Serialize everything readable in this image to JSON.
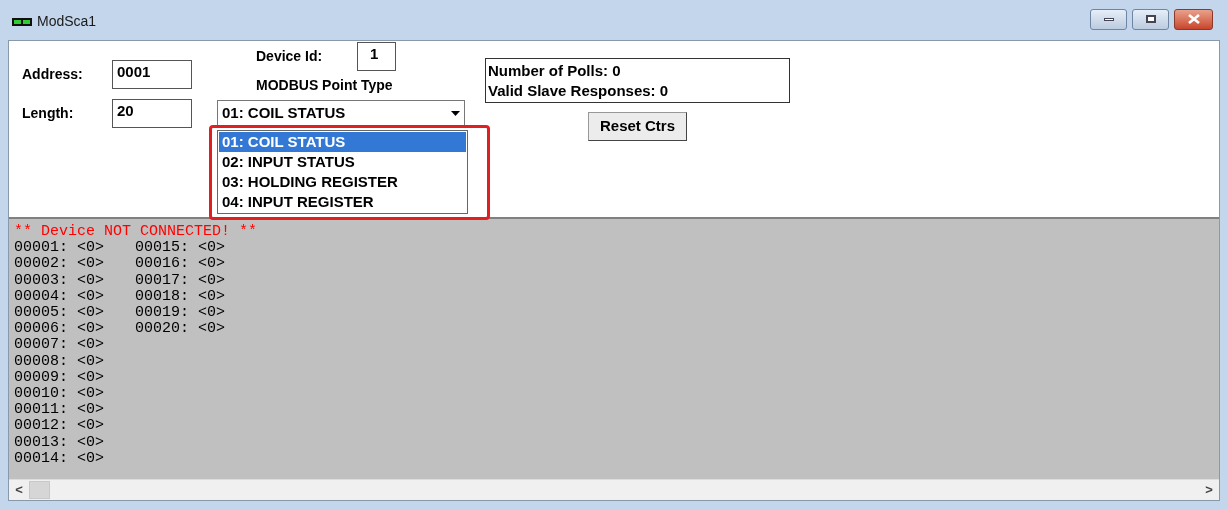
{
  "window": {
    "title": "ModSca1"
  },
  "fields": {
    "address_label": "Address:",
    "address": "0001",
    "length_label": "Length:",
    "length": "20",
    "device_id_label": "Device Id:",
    "device_id": "1",
    "point_type_label": "MODBUS Point Type"
  },
  "point_type": {
    "value": "01: COIL STATUS",
    "expanded": true,
    "options": [
      {
        "label": "01: COIL STATUS",
        "selected": true
      },
      {
        "label": "02: INPUT STATUS",
        "selected": false
      },
      {
        "label": "03: HOLDING REGISTER",
        "selected": false
      },
      {
        "label": "04: INPUT REGISTER",
        "selected": false
      }
    ]
  },
  "counters": [
    "Number of Polls: 0",
    "Valid Slave Responses: 0"
  ],
  "reset_button": "Reset Ctrs",
  "output": {
    "status": "** Device NOT CONNECTED! **",
    "readings": [
      "00001: <0>",
      "00002: <0>",
      "00003: <0>",
      "00004: <0>",
      "00005: <0>",
      "00006: <0>",
      "00007: <0>",
      "00008: <0>",
      "00009: <0>",
      "00010: <0>",
      "00011: <0>",
      "00012: <0>",
      "00013: <0>",
      "00014: <0>",
      "00015: <0>",
      "00016: <0>",
      "00017: <0>",
      "00018: <0>",
      "00019: <0>",
      "00020: <0>"
    ]
  },
  "scroll": {
    "left": "<",
    "right": ">"
  }
}
